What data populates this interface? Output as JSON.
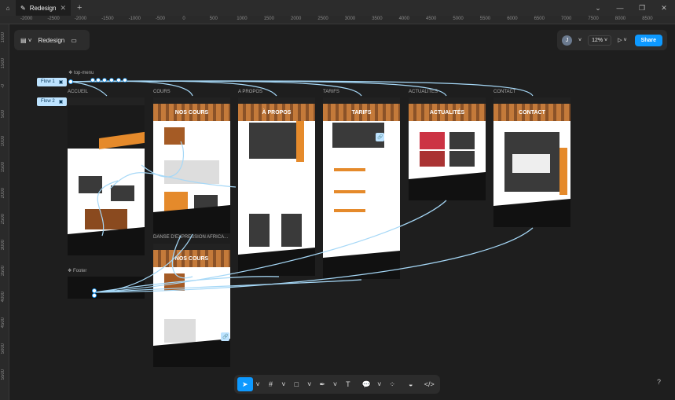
{
  "titlebar": {
    "tab_title": "Redesign",
    "home_icon": "home-icon",
    "file_icon": "figma-file-icon"
  },
  "ruler": {
    "top": [
      "-2000",
      "-2500",
      "-2000",
      "-1500",
      "-1000",
      "-500",
      "0",
      "500",
      "1000",
      "1500",
      "2000",
      "2500",
      "3000",
      "3500",
      "4000",
      "4500",
      "5000",
      "5500",
      "6000",
      "6500",
      "7000",
      "7500",
      "8000",
      "8500"
    ],
    "left": [
      "1000",
      "1500",
      "-0",
      "500",
      "1000",
      "1500",
      "2000",
      "2500",
      "3000",
      "3500",
      "4000",
      "4500",
      "5000",
      "5500"
    ]
  },
  "left_panel": {
    "file_name": "Redesign"
  },
  "right_panel": {
    "avatar_initial": "J",
    "zoom": "12%",
    "share_label": "Share"
  },
  "canvas": {
    "top_menu_label": "top-menu",
    "footer_label": "Footer",
    "flow1": "Flow 1",
    "flow2": "Flow 2",
    "frames": {
      "accueil": "ACCUEIL",
      "cours": "COURS",
      "apropos": "A PROPOS",
      "tarifs": "TARIFS",
      "actualites": "ACTUALITES",
      "contact": "CONTACT",
      "danse": "DANSE D'EXPRESSION AFRICA..."
    },
    "headings": {
      "cours": "NOS COURS",
      "apropos": "À PROPOS",
      "tarifs": "TARIFS",
      "actualites": "ACTUALITÉS",
      "contact": "CONTACT",
      "danse": "NOS COURS"
    }
  },
  "help": "?"
}
